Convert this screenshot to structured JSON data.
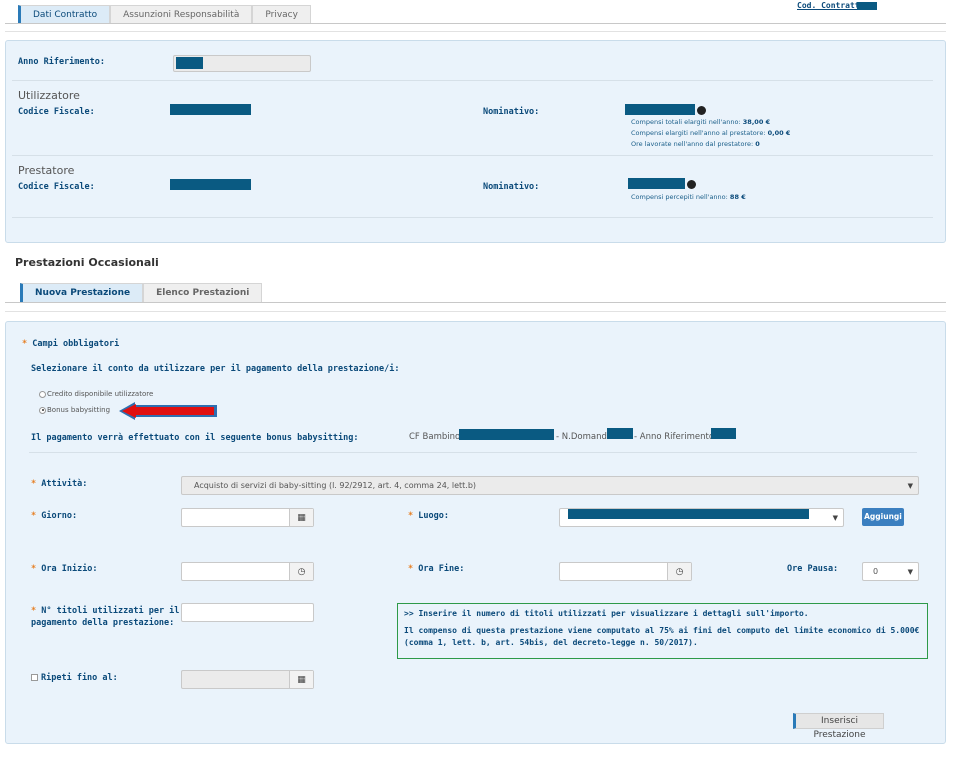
{
  "top_tabs": [
    "Dati Contratto",
    "Assunzioni Responsabilità",
    "Privacy"
  ],
  "cod_contratto_label": "Cod. Contratto:",
  "anno_riferimento_label": "Anno Riferimento:",
  "utilizzatore": {
    "title": "Utilizzatore",
    "cf_label": "Codice Fiscale:",
    "nominativo_label": "Nominativo:",
    "compensi_totali": "Compensi totali elargiti nell'anno:",
    "compensi_totali_val": "38,00 €",
    "compensi_prestatore": "Compensi elargiti nell'anno al prestatore:",
    "compensi_prestatore_val": "0,00 €",
    "ore_lavorate": "Ore lavorate nell'anno dal prestatore:",
    "ore_lavorate_val": "0"
  },
  "prestatore": {
    "title": "Prestatore",
    "cf_label": "Codice Fiscale:",
    "nominativo_label": "Nominativo:",
    "compensi_percepiti": "Compensi percepiti nell'anno:",
    "compensi_percepiti_val": "88 €"
  },
  "prestazioni_title": "Prestazioni Occasionali",
  "sub_tabs": [
    "Nuova Prestazione",
    "Elenco Prestazioni"
  ],
  "form": {
    "campi_obbligatori": "Campi obbligatori",
    "selezionare_conto": "Selezionare il conto da utilizzare per il pagamento della prestazione/i:",
    "radio_credito": "Credito disponibile utilizzatore",
    "radio_bonus": "Bonus babysitting",
    "pagamento_label": "Il pagamento verrà effettuato con il seguente bonus babysitting:",
    "cf_bambino": "CF Bambino:",
    "n_domanda": "- N.Domanda:",
    "anno_rif": "- Anno Riferimento:",
    "attivita_label": "Attività:",
    "attivita_value": "Acquisto di servizi di baby-sitting (l. 92/2912, art. 4, comma 24, lett.b)",
    "giorno_label": "Giorno:",
    "luogo_label": "Luogo:",
    "aggiungi": "Aggiungi",
    "ora_inizio_label": "Ora Inizio:",
    "ora_fine_label": "Ora Fine:",
    "ore_pausa_label": "Ore Pausa:",
    "ore_pausa_value": "0",
    "titoli_label_1": "N° titoli utilizzati per il",
    "titoli_label_2": "pagamento della prestazione:",
    "info_line1": ">> Inserire il numero di titoli utilizzati per visualizzare i dettagli sull'importo.",
    "info_line2": "Il compenso di questa prestazione viene computato al 75% ai fini del computo del limite economico di 5.000€ (comma 1, lett. b, art. 54bis, del decreto-legge n. 50/2017).",
    "ripeti_label": "Ripeti fino al:",
    "inserisci": "Inserisci Prestazione"
  },
  "colors": {
    "accent": "#0b4a7a",
    "redaction": "#0a5a82",
    "panel": "#eaf3fb",
    "arrow": "#e01010"
  }
}
